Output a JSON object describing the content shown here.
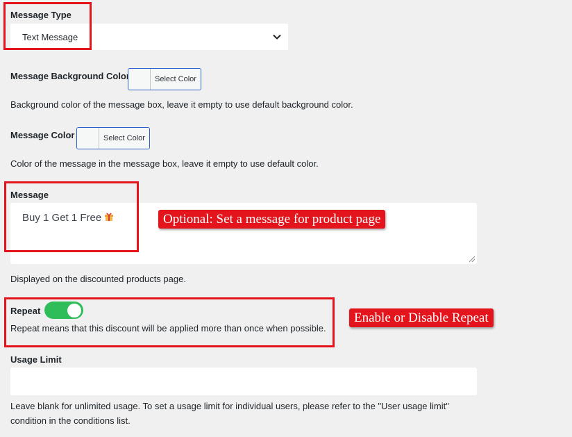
{
  "message_type": {
    "label": "Message Type",
    "selected": "Text Message"
  },
  "bg_color": {
    "label": "Message Background Color",
    "button_text": "Select Color",
    "description": "Background color of the message box, leave it empty to use default background color."
  },
  "msg_color": {
    "label": "Message Color",
    "button_text": "Select Color",
    "description": "Color of the message in the message box, leave it empty to use default color."
  },
  "message": {
    "label": "Message",
    "value": "Buy 1 Get 1 Free",
    "emoji_icon": "gift-icon",
    "description": "Displayed on the discounted products page."
  },
  "repeat": {
    "label": "Repeat",
    "enabled": true,
    "description": "Repeat means that this discount will be applied more than once when possible."
  },
  "usage_limit": {
    "label": "Usage Limit",
    "value": "",
    "description_line1": "Leave blank for unlimited usage. To set a usage limit for individual users, please refer to the \"User usage limit\"",
    "description_line2": "condition in the conditions list."
  },
  "annotations": {
    "message_callout": "Optional: Set a message for product page",
    "repeat_callout": "Enable or Disable Repeat"
  },
  "colors": {
    "highlight_red": "#e3141b",
    "toggle_on": "#2ebd59",
    "page_bg": "#f0f0f1"
  }
}
